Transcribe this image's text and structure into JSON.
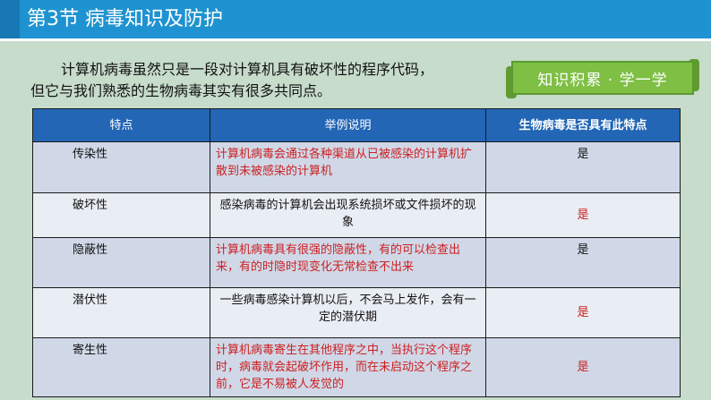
{
  "header": {
    "title": "第3节  病毒知识及防护"
  },
  "intro": {
    "line1": "计算机病毒虽然只是一段对计算机具有破坏性的程序代码，",
    "line2": "但它与我们熟悉的生物病毒其实有很多共同点。"
  },
  "banner": {
    "label": "知识积累 · 学一学"
  },
  "table": {
    "headers": [
      "特点",
      "举例说明",
      "生物病毒是否具有此特点"
    ],
    "rows": [
      {
        "feature": "传染性",
        "example": "计算机病毒会通过各种渠道从已被感染的计算机扩散到未被感染的计算机",
        "answer": "是"
      },
      {
        "feature": "破坏性",
        "example": "感染病毒的计算机会出现系统损坏或文件损坏的现象",
        "answer": "是"
      },
      {
        "feature": "隐蔽性",
        "example": "计算机病毒具有很强的隐蔽性，有的可以检查出来，有的时隐时现变化无常检查不出来",
        "answer": "是"
      },
      {
        "feature": "潜伏性",
        "example": "一些病毒感染计算机以后，不会马上发作，会有一定的潜伏期",
        "answer": "是"
      },
      {
        "feature": "寄生性",
        "example": "计算机病毒寄生在其他程序之中，当执行这个程序时，病毒就会起破坏作用，而在未启动这个程序之前，它是不易被人发觉的",
        "answer": "是"
      }
    ]
  },
  "colors": {
    "header_bg": "#1f93d1",
    "page_bg": "#c7dccb",
    "table_header_bg": "#2266b5",
    "highlight_red": "#cc1f1f",
    "banner_green": "#7ebf44"
  }
}
